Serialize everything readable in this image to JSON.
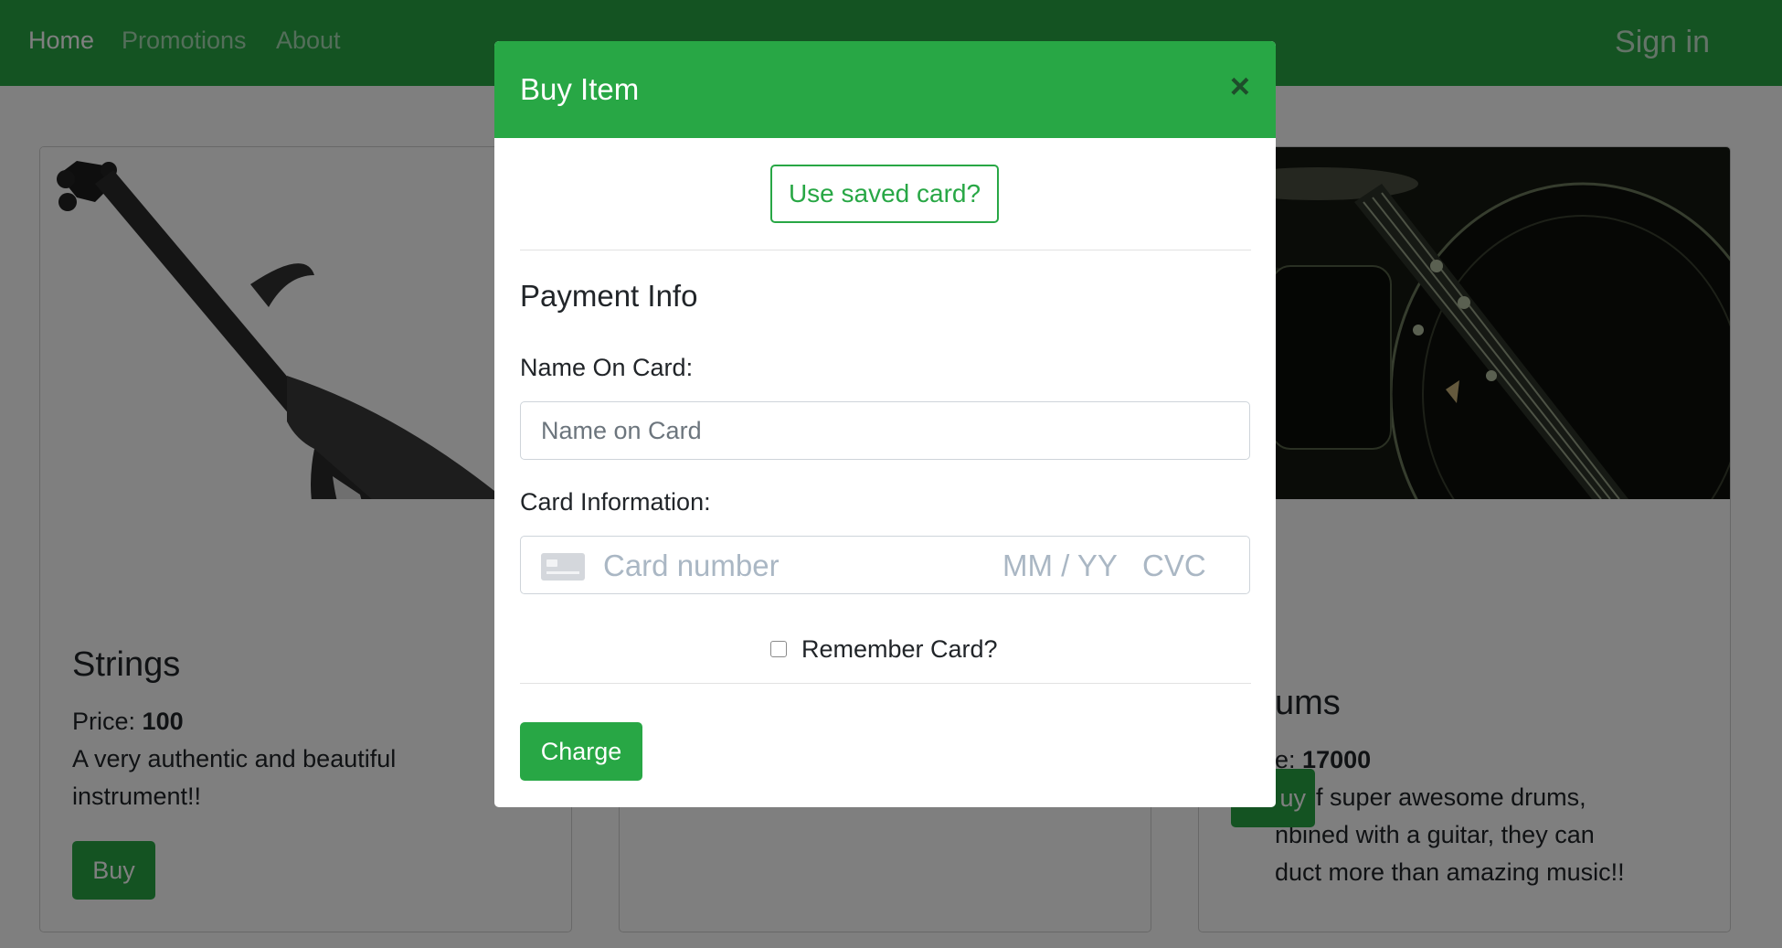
{
  "navbar": {
    "links": [
      {
        "label": "Home"
      },
      {
        "label": "Promotions"
      },
      {
        "label": "About"
      }
    ],
    "signin_label": "Sign in"
  },
  "cards": [
    {
      "title": "Strings",
      "price_label": "Price:",
      "price": "100",
      "description": "A very authentic and beautiful instrument!!",
      "buy_label": "Buy"
    },
    {
      "title": "ums",
      "price_label": "e:",
      "price": "17000",
      "description_lines": [
        "et of super awesome drums,",
        "nbined with a guitar, they can",
        "duct more than amazing music!!"
      ],
      "buy_label": "uy"
    }
  ],
  "modal": {
    "title": "Buy Item",
    "close_symbol": "×",
    "saved_card_label": "Use saved card?",
    "section_title": "Payment Info",
    "name_label": "Name On Card:",
    "name_placeholder": "Name on Card",
    "card_label": "Card Information:",
    "card_number_placeholder": "Card number",
    "expiry_placeholder": "MM / YY",
    "cvc_placeholder": "CVC",
    "card_icon": "credit-card-icon",
    "remember_label": "Remember Card?",
    "remember_checked": false,
    "charge_label": "Charge"
  },
  "colors": {
    "brand": "#28a745",
    "backdrop": "rgba(0,0,0,0.5)"
  }
}
